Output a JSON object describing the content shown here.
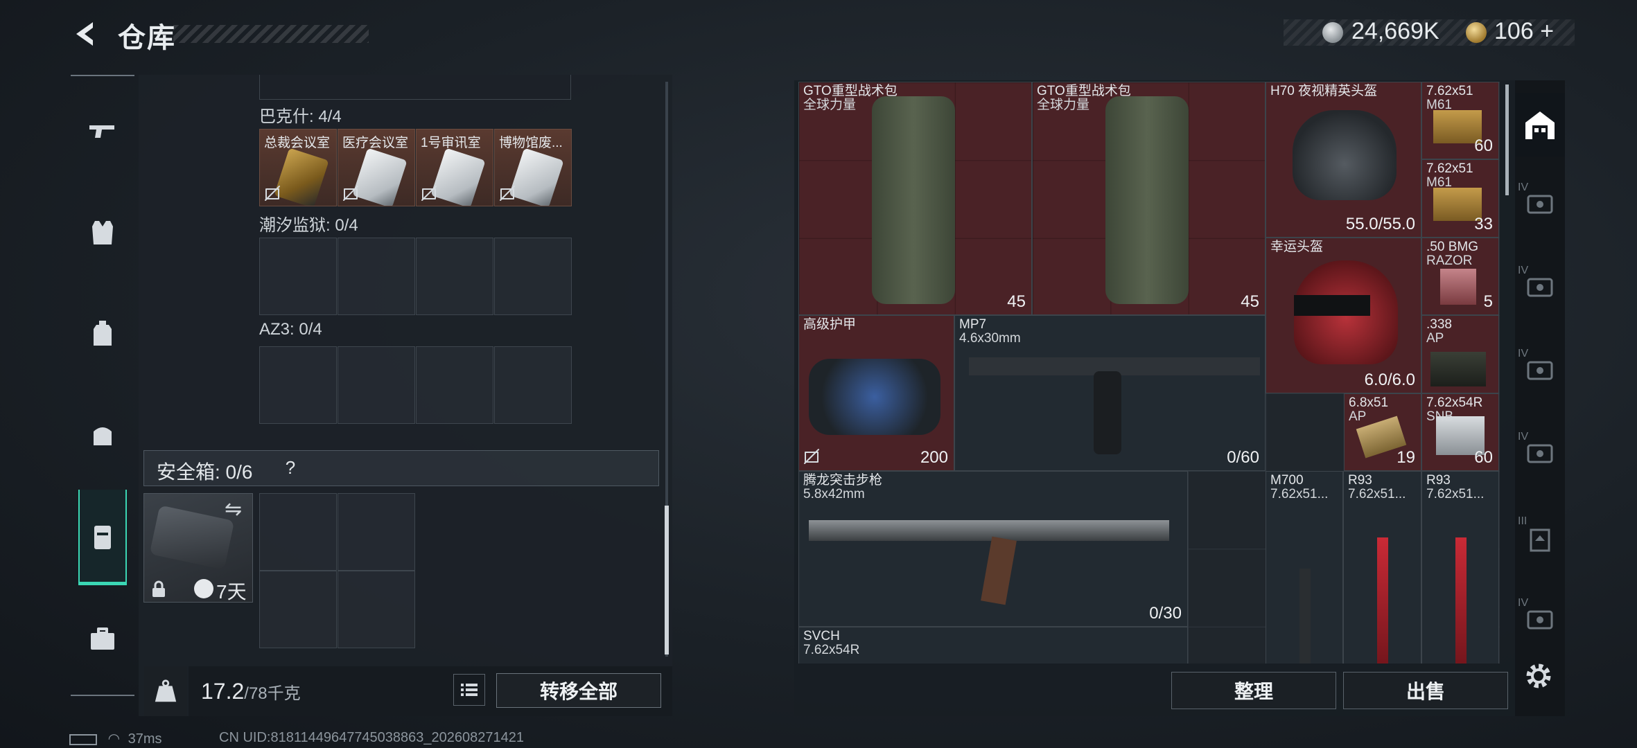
{
  "header": {
    "title": "仓库"
  },
  "currency": {
    "silver": "24,669K",
    "gold": "106",
    "gold_plus": "+"
  },
  "nav": [
    "pistol-icon",
    "armor-vest-icon",
    "backpack-icon",
    "chest-rig-icon",
    "safe-case-icon",
    "briefcase-icon"
  ],
  "left": {
    "groups": [
      {
        "label": "巴克什: 4/4",
        "cards": [
          {
            "name": "总裁会议室",
            "art": "gold"
          },
          {
            "name": "医疗会议室",
            "art": "white"
          },
          {
            "name": "1号审讯室",
            "art": "white"
          },
          {
            "name": "博物馆废...",
            "art": "white"
          }
        ]
      },
      {
        "label": "潮汐监狱: 0/4"
      },
      {
        "label": "AZ3: 0/4"
      }
    ],
    "safe_label": "安全箱: 0/6",
    "safe_help": "?",
    "safe_days": "7天",
    "weight_current": "17.2",
    "weight_max": "/78千克",
    "transfer_all": "转移全部"
  },
  "stash": {
    "items": [
      {
        "name": "GTO重型战术包",
        "sub": "全球力量",
        "val": "45"
      },
      {
        "name": "GTO重型战术包",
        "sub": "全球力量",
        "val": "45"
      },
      {
        "name": "H70 夜视精英头盔",
        "val": "55.0/55.0"
      },
      {
        "name": "7.62x51",
        "sub": "M61",
        "val": "60"
      },
      {
        "name": "7.62x51",
        "sub": "M61",
        "val": "33"
      },
      {
        "name": "幸运头盔",
        "val": "6.0/6.0"
      },
      {
        "name": ".50 BMG",
        "sub": "RAZOR",
        "val": "5"
      },
      {
        "name": "高级护甲",
        "val": "200"
      },
      {
        "name": "MP7",
        "sub": "4.6x30mm",
        "val": "0/60"
      },
      {
        "name": ".338",
        "sub": "AP",
        "val": ""
      },
      {
        "name": "6.8x51",
        "sub": "AP",
        "val": "19"
      },
      {
        "name": "7.62x54R",
        "sub": "SNB",
        "val": "60"
      },
      {
        "name": "腾龙突击步枪",
        "sub": "5.8x42mm",
        "val": "0/30"
      },
      {
        "name": "M700",
        "sub": "7.62x51..."
      },
      {
        "name": "R93",
        "sub": "7.62x51..."
      },
      {
        "name": "R93",
        "sub": "7.62x51..."
      },
      {
        "name": "SVCH",
        "sub": "7.62x54R"
      }
    ],
    "sort_btn": "整理",
    "sell_btn": "出售"
  },
  "side_tabs": [
    "IV",
    "IV",
    "IV",
    "IV",
    "III",
    "IV"
  ],
  "status": {
    "ping": "37ms",
    "uid": "CN UID:8181144964774503886​3_202608271421"
  }
}
